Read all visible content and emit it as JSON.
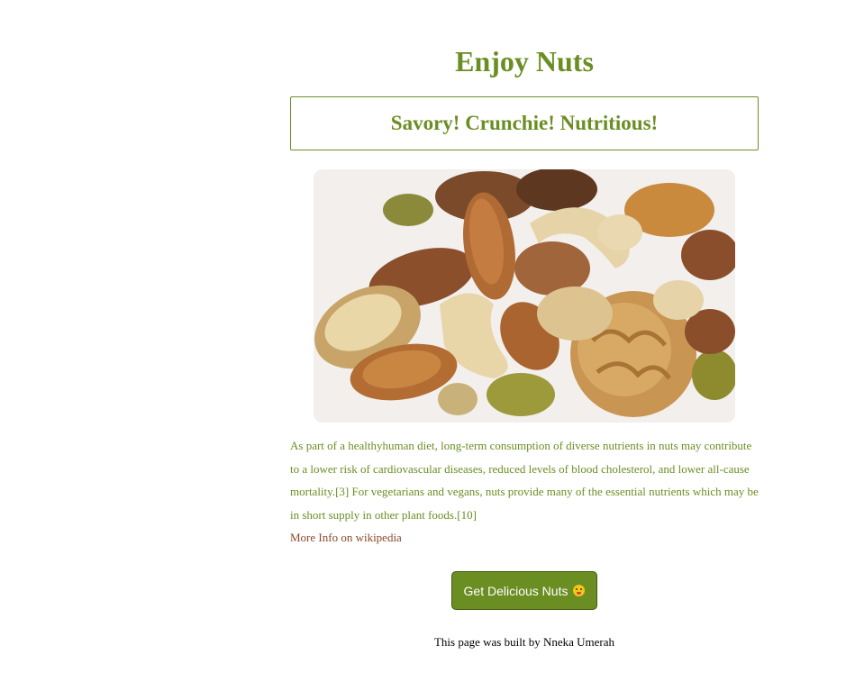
{
  "header": {
    "title": "Enjoy Nuts",
    "tagline": "Savory! Crunchie! Nutritious!"
  },
  "hero_image": {
    "icon": "mixed-nuts-photo"
  },
  "content": {
    "description": "As part of a healthyhuman diet, long-term consumption of diverse nutrients in nuts may contribute to a lower risk of cardiovascular diseases, reduced levels of blood cholesterol, and lower all-cause mortality.[3] For vegetarians and vegans, nuts provide many of the essential nutrients which may be in short supply in other plant foods.[10]",
    "more_info_link": "More Info on wikipedia"
  },
  "cta": {
    "label": "Get Delicious Nuts",
    "icon": "yum-face-emoji"
  },
  "footer": {
    "credit": "This page was built by Nneka Umerah"
  },
  "colors": {
    "accent": "#6b8e23",
    "link": "#8b4a2b",
    "button_text": "#ffffff"
  }
}
